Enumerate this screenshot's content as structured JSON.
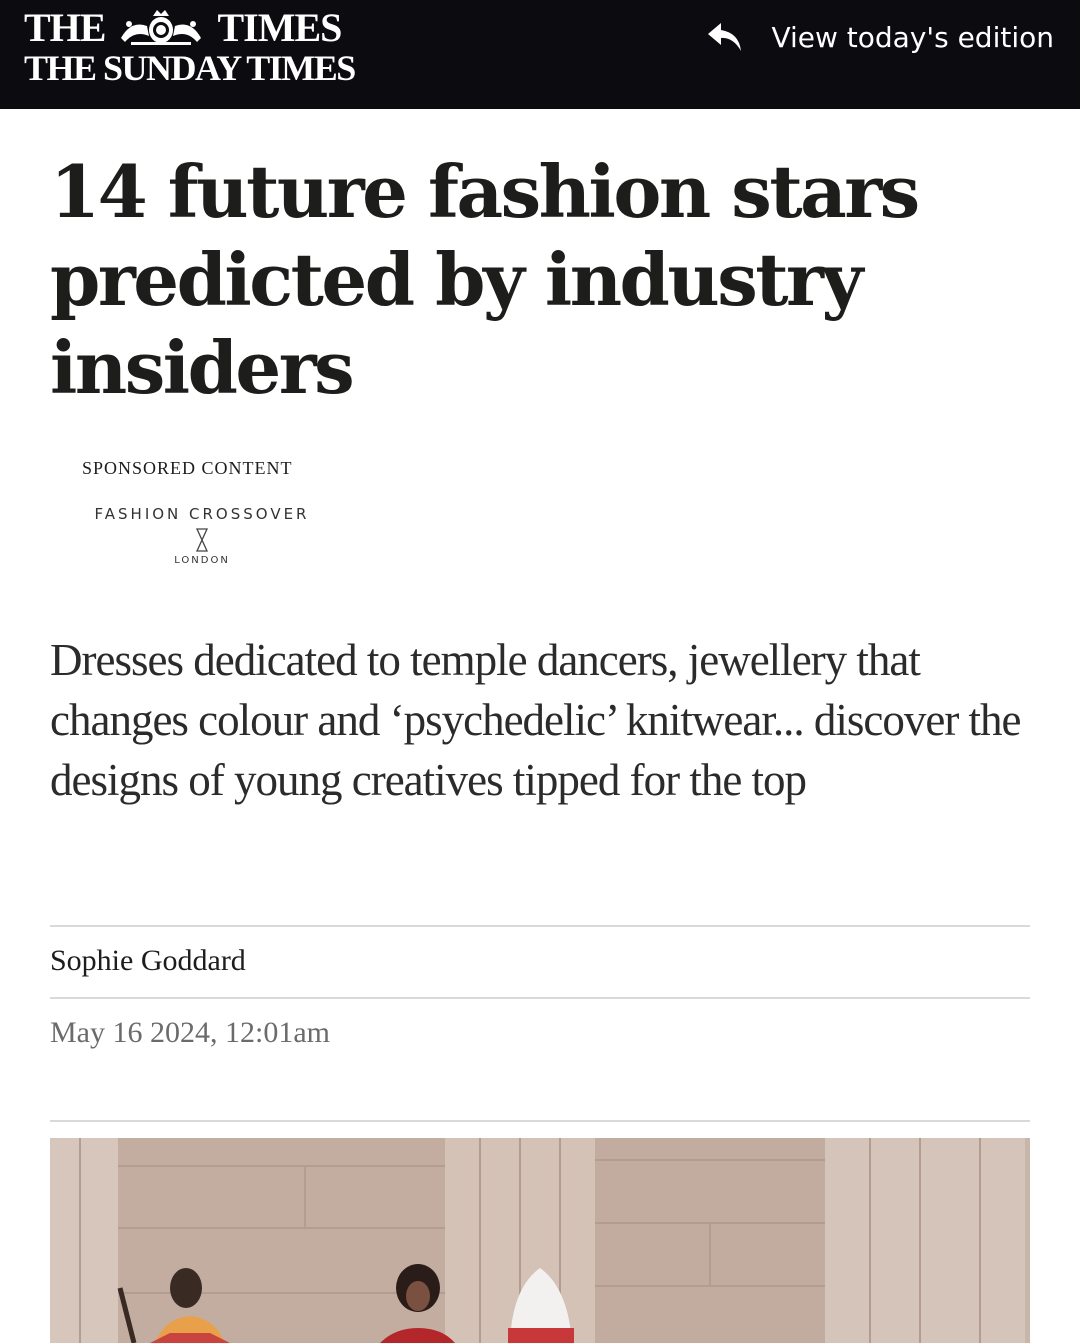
{
  "masthead": {
    "line1_left": "THE",
    "line1_right": "TIMES",
    "line2": "THE SUNDAY TIMES",
    "crest_icon": "royal-crest-icon"
  },
  "header": {
    "view_edition_label": "View today's edition",
    "view_edition_icon": "reply-arrow-icon"
  },
  "article": {
    "headline": "14 future fashion stars predicted by industry insiders",
    "sponsored_label": "SPONSORED CONTENT",
    "sponsor": {
      "name": "FASHION CROSSOVER",
      "city": "LONDON"
    },
    "standfirst": "Dresses dedicated to temple dancers, jewellery that changes colour and ‘psychedelic’ knitwear... discover the designs of young creatives tipped for the top",
    "author": "Sophie Goddard",
    "date": "May 16 2024, 12:01am"
  },
  "colors": {
    "topbar": "#0b0b10",
    "text": "#1d1d1b",
    "muted": "#6b6b6b",
    "rule": "#d9d9d9"
  }
}
